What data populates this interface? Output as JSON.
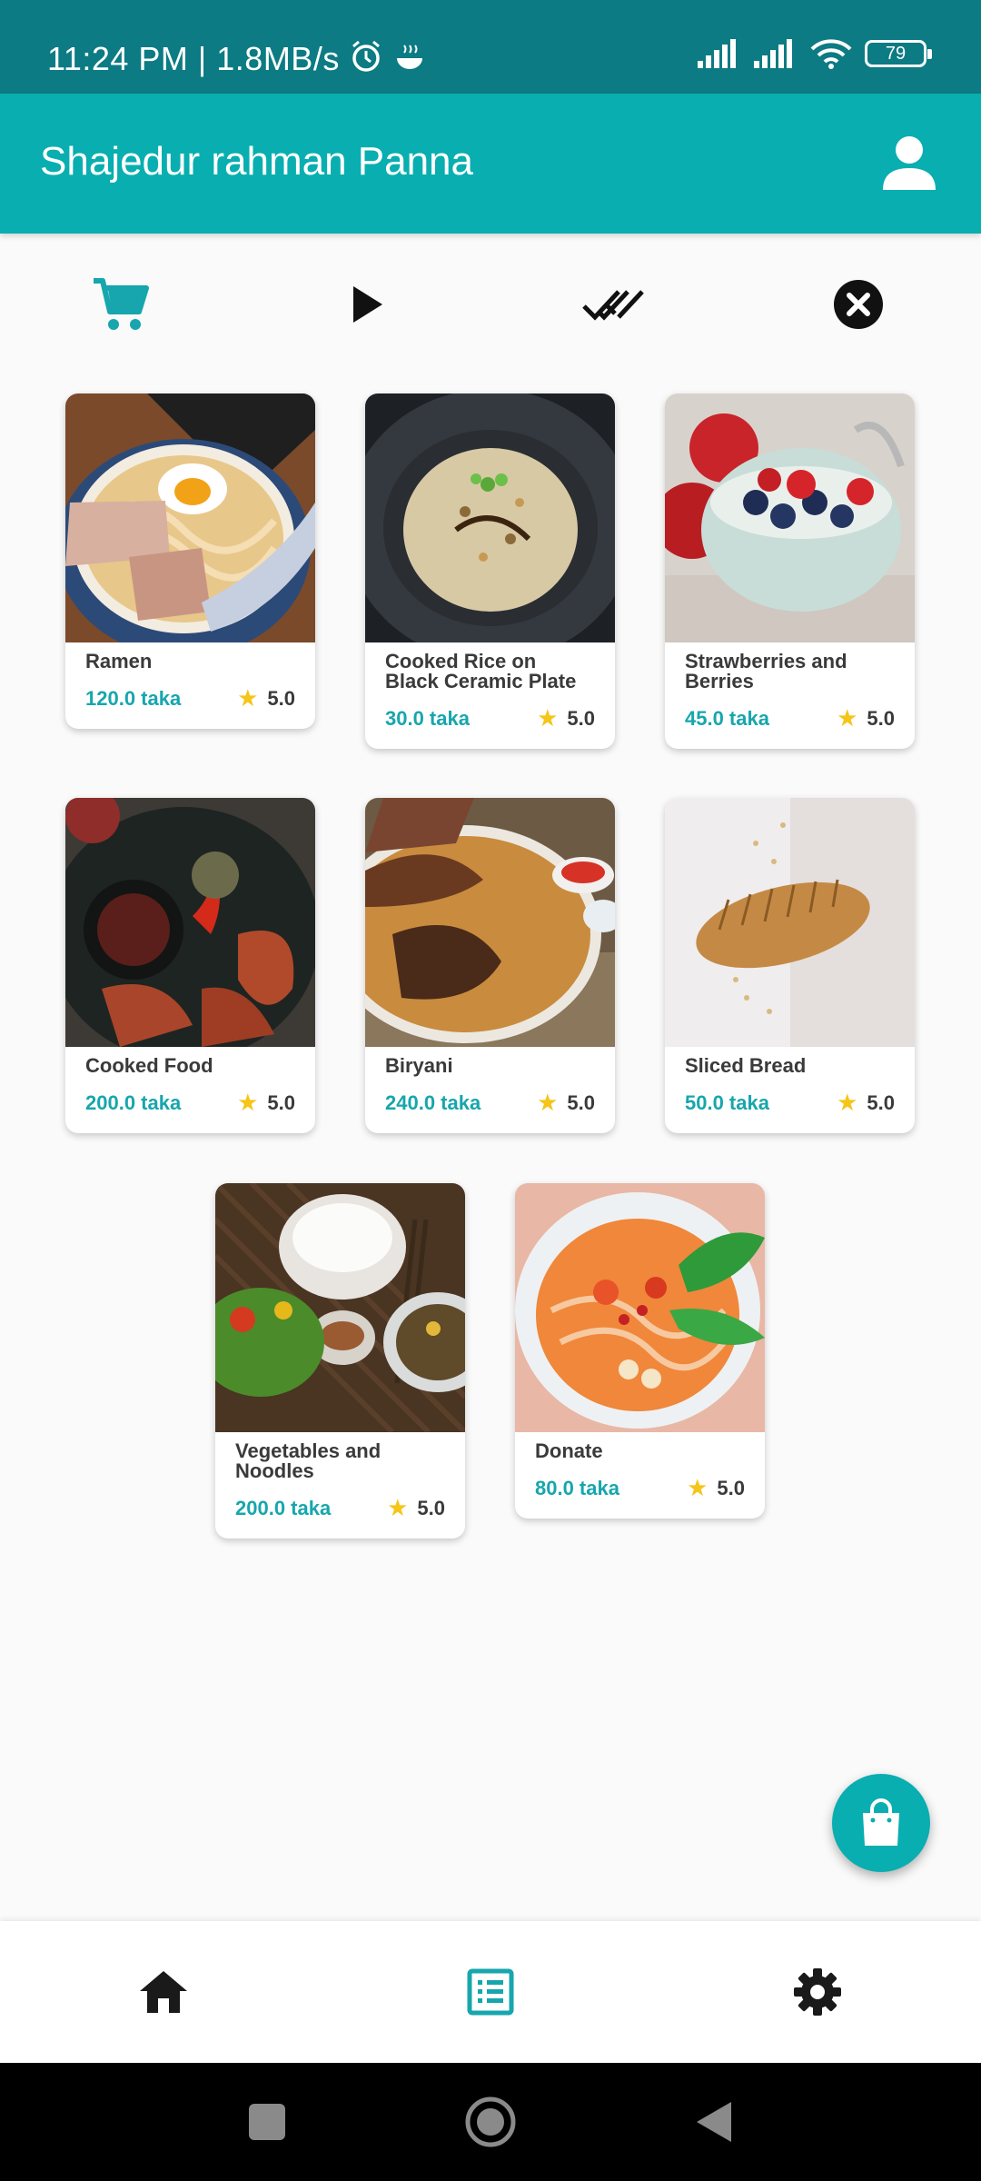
{
  "status_bar": {
    "time_speed": "11:24 PM | 1.8MB/s",
    "battery": "79",
    "icons": [
      "alarm-icon",
      "bowl-icon",
      "signal-icon",
      "signal-icon",
      "wifi-icon",
      "battery-icon"
    ]
  },
  "app_bar": {
    "title": "Shajedur rahman Panna",
    "icon": "person-icon"
  },
  "tabs": [
    {
      "icon": "cart-icon",
      "active": true
    },
    {
      "icon": "play-icon",
      "active": false
    },
    {
      "icon": "double-check-icon",
      "active": false
    },
    {
      "icon": "close-circle-icon",
      "active": false
    }
  ],
  "products": [
    {
      "name": "Ramen",
      "price": "120.0 taka",
      "rating": "5.0"
    },
    {
      "name": "Cooked Rice on Black Ceramic Plate",
      "price": "30.0 taka",
      "rating": "5.0"
    },
    {
      "name": "Strawberries and Berries",
      "price": "45.0 taka",
      "rating": "5.0"
    },
    {
      "name": "Cooked Food",
      "price": "200.0 taka",
      "rating": "5.0"
    },
    {
      "name": "Biryani",
      "price": "240.0 taka",
      "rating": "5.0"
    },
    {
      "name": "Sliced Bread",
      "price": "50.0 taka",
      "rating": "5.0"
    },
    {
      "name": "Vegetables and Noodles",
      "price": "200.0 taka",
      "rating": "5.0"
    },
    {
      "name": "Donate",
      "price": "80.0 taka",
      "rating": "5.0"
    }
  ],
  "fab": {
    "icon": "shopping-bag-icon"
  },
  "bottom_nav": [
    {
      "icon": "home-icon",
      "active": false
    },
    {
      "icon": "list-icon",
      "active": true
    },
    {
      "icon": "settings-icon",
      "active": false
    }
  ],
  "colors": {
    "status_bar": "#0c7b83",
    "app_bar": "#09aeb0",
    "accent": "#17a6ad",
    "star": "#f5c518"
  }
}
